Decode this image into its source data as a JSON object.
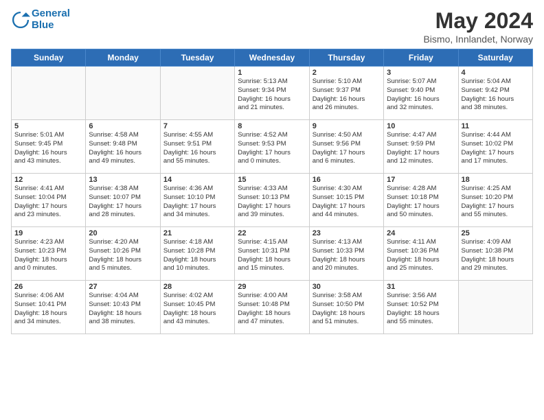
{
  "logo": {
    "line1": "General",
    "line2": "Blue"
  },
  "title": "May 2024",
  "subtitle": "Bismo, Innlandet, Norway",
  "days_of_week": [
    "Sunday",
    "Monday",
    "Tuesday",
    "Wednesday",
    "Thursday",
    "Friday",
    "Saturday"
  ],
  "weeks": [
    [
      {
        "num": "",
        "info": "",
        "empty": true
      },
      {
        "num": "",
        "info": "",
        "empty": true
      },
      {
        "num": "",
        "info": "",
        "empty": true
      },
      {
        "num": "1",
        "info": "Sunrise: 5:13 AM\nSunset: 9:34 PM\nDaylight: 16 hours\nand 21 minutes.",
        "empty": false
      },
      {
        "num": "2",
        "info": "Sunrise: 5:10 AM\nSunset: 9:37 PM\nDaylight: 16 hours\nand 26 minutes.",
        "empty": false
      },
      {
        "num": "3",
        "info": "Sunrise: 5:07 AM\nSunset: 9:40 PM\nDaylight: 16 hours\nand 32 minutes.",
        "empty": false
      },
      {
        "num": "4",
        "info": "Sunrise: 5:04 AM\nSunset: 9:42 PM\nDaylight: 16 hours\nand 38 minutes.",
        "empty": false
      }
    ],
    [
      {
        "num": "5",
        "info": "Sunrise: 5:01 AM\nSunset: 9:45 PM\nDaylight: 16 hours\nand 43 minutes.",
        "empty": false
      },
      {
        "num": "6",
        "info": "Sunrise: 4:58 AM\nSunset: 9:48 PM\nDaylight: 16 hours\nand 49 minutes.",
        "empty": false
      },
      {
        "num": "7",
        "info": "Sunrise: 4:55 AM\nSunset: 9:51 PM\nDaylight: 16 hours\nand 55 minutes.",
        "empty": false
      },
      {
        "num": "8",
        "info": "Sunrise: 4:52 AM\nSunset: 9:53 PM\nDaylight: 17 hours\nand 0 minutes.",
        "empty": false
      },
      {
        "num": "9",
        "info": "Sunrise: 4:50 AM\nSunset: 9:56 PM\nDaylight: 17 hours\nand 6 minutes.",
        "empty": false
      },
      {
        "num": "10",
        "info": "Sunrise: 4:47 AM\nSunset: 9:59 PM\nDaylight: 17 hours\nand 12 minutes.",
        "empty": false
      },
      {
        "num": "11",
        "info": "Sunrise: 4:44 AM\nSunset: 10:02 PM\nDaylight: 17 hours\nand 17 minutes.",
        "empty": false
      }
    ],
    [
      {
        "num": "12",
        "info": "Sunrise: 4:41 AM\nSunset: 10:04 PM\nDaylight: 17 hours\nand 23 minutes.",
        "empty": false
      },
      {
        "num": "13",
        "info": "Sunrise: 4:38 AM\nSunset: 10:07 PM\nDaylight: 17 hours\nand 28 minutes.",
        "empty": false
      },
      {
        "num": "14",
        "info": "Sunrise: 4:36 AM\nSunset: 10:10 PM\nDaylight: 17 hours\nand 34 minutes.",
        "empty": false
      },
      {
        "num": "15",
        "info": "Sunrise: 4:33 AM\nSunset: 10:13 PM\nDaylight: 17 hours\nand 39 minutes.",
        "empty": false
      },
      {
        "num": "16",
        "info": "Sunrise: 4:30 AM\nSunset: 10:15 PM\nDaylight: 17 hours\nand 44 minutes.",
        "empty": false
      },
      {
        "num": "17",
        "info": "Sunrise: 4:28 AM\nSunset: 10:18 PM\nDaylight: 17 hours\nand 50 minutes.",
        "empty": false
      },
      {
        "num": "18",
        "info": "Sunrise: 4:25 AM\nSunset: 10:20 PM\nDaylight: 17 hours\nand 55 minutes.",
        "empty": false
      }
    ],
    [
      {
        "num": "19",
        "info": "Sunrise: 4:23 AM\nSunset: 10:23 PM\nDaylight: 18 hours\nand 0 minutes.",
        "empty": false
      },
      {
        "num": "20",
        "info": "Sunrise: 4:20 AM\nSunset: 10:26 PM\nDaylight: 18 hours\nand 5 minutes.",
        "empty": false
      },
      {
        "num": "21",
        "info": "Sunrise: 4:18 AM\nSunset: 10:28 PM\nDaylight: 18 hours\nand 10 minutes.",
        "empty": false
      },
      {
        "num": "22",
        "info": "Sunrise: 4:15 AM\nSunset: 10:31 PM\nDaylight: 18 hours\nand 15 minutes.",
        "empty": false
      },
      {
        "num": "23",
        "info": "Sunrise: 4:13 AM\nSunset: 10:33 PM\nDaylight: 18 hours\nand 20 minutes.",
        "empty": false
      },
      {
        "num": "24",
        "info": "Sunrise: 4:11 AM\nSunset: 10:36 PM\nDaylight: 18 hours\nand 25 minutes.",
        "empty": false
      },
      {
        "num": "25",
        "info": "Sunrise: 4:09 AM\nSunset: 10:38 PM\nDaylight: 18 hours\nand 29 minutes.",
        "empty": false
      }
    ],
    [
      {
        "num": "26",
        "info": "Sunrise: 4:06 AM\nSunset: 10:41 PM\nDaylight: 18 hours\nand 34 minutes.",
        "empty": false
      },
      {
        "num": "27",
        "info": "Sunrise: 4:04 AM\nSunset: 10:43 PM\nDaylight: 18 hours\nand 38 minutes.",
        "empty": false
      },
      {
        "num": "28",
        "info": "Sunrise: 4:02 AM\nSunset: 10:45 PM\nDaylight: 18 hours\nand 43 minutes.",
        "empty": false
      },
      {
        "num": "29",
        "info": "Sunrise: 4:00 AM\nSunset: 10:48 PM\nDaylight: 18 hours\nand 47 minutes.",
        "empty": false
      },
      {
        "num": "30",
        "info": "Sunrise: 3:58 AM\nSunset: 10:50 PM\nDaylight: 18 hours\nand 51 minutes.",
        "empty": false
      },
      {
        "num": "31",
        "info": "Sunrise: 3:56 AM\nSunset: 10:52 PM\nDaylight: 18 hours\nand 55 minutes.",
        "empty": false
      },
      {
        "num": "",
        "info": "",
        "empty": true
      }
    ]
  ]
}
